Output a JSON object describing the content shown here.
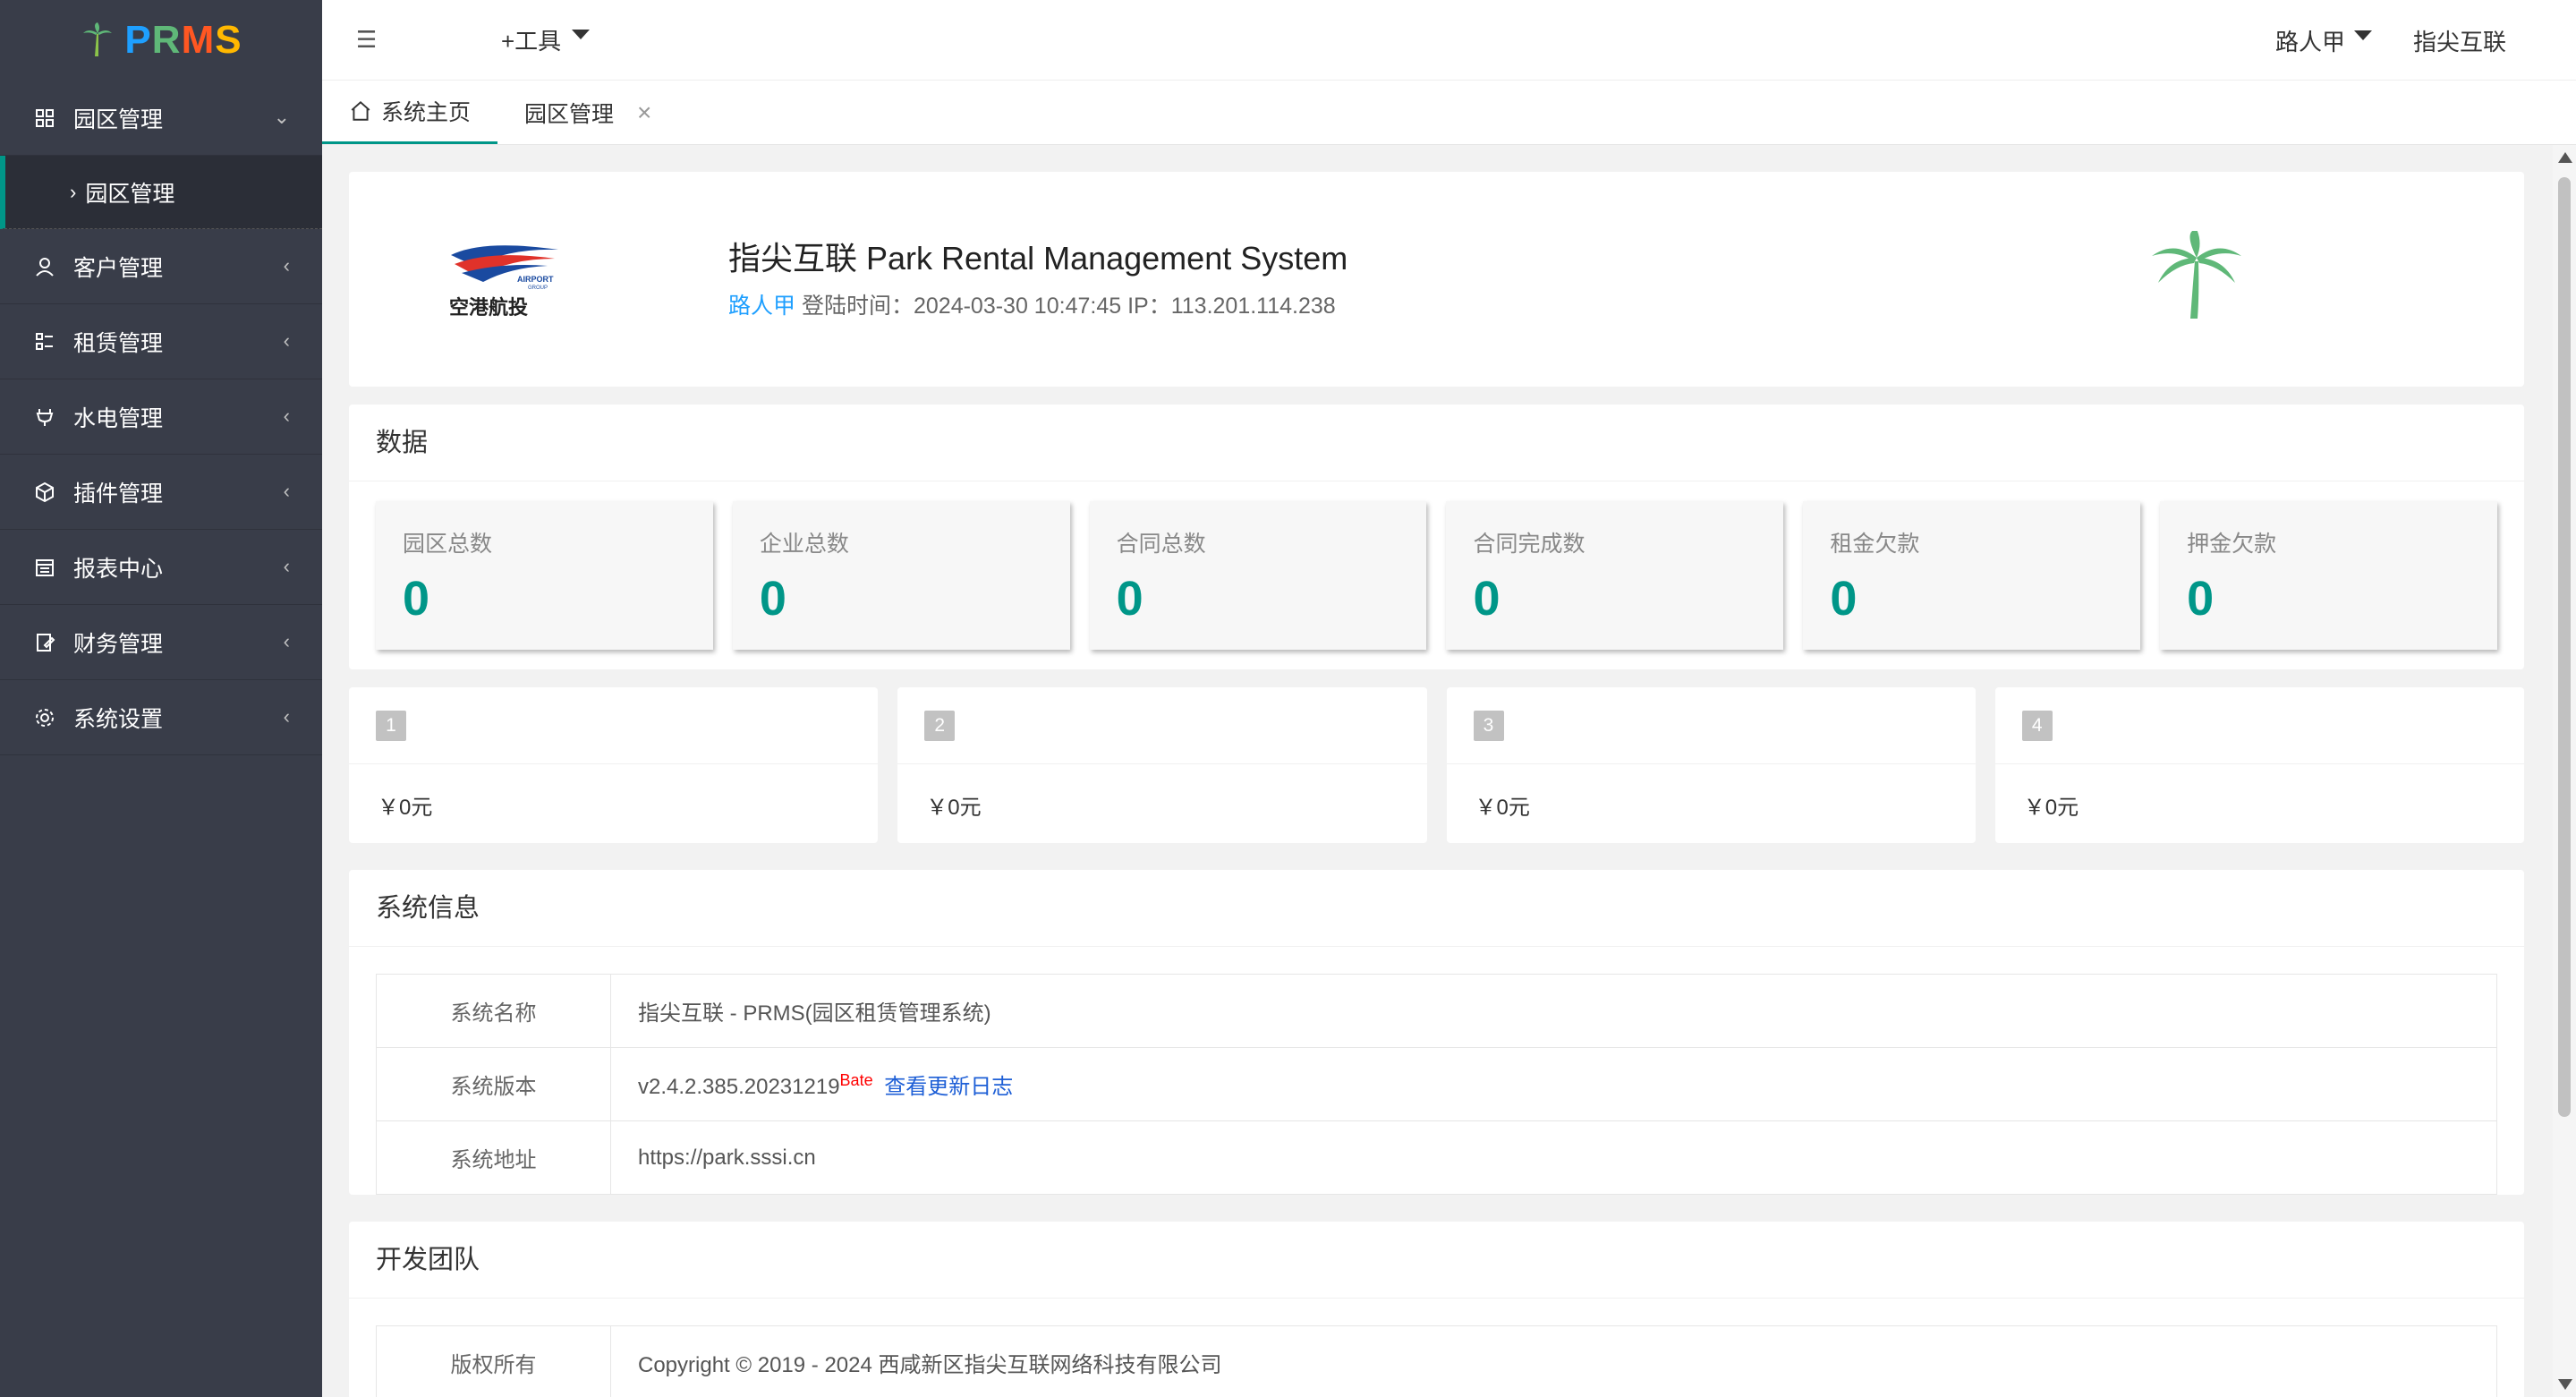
{
  "app": {
    "logo_letters": [
      "P",
      "R",
      "M",
      "S"
    ]
  },
  "colors": {
    "sidebar_bg": "#393d49",
    "accent": "#009688",
    "link_blue": "#1e9fff"
  },
  "sidebar": {
    "items": [
      {
        "label": "园区管理",
        "icon": "grid-icon",
        "expanded": true
      },
      {
        "label": "客户管理",
        "icon": "user-icon"
      },
      {
        "label": "租赁管理",
        "icon": "list-icon"
      },
      {
        "label": "水电管理",
        "icon": "plug-icon"
      },
      {
        "label": "插件管理",
        "icon": "cube-icon"
      },
      {
        "label": "报表中心",
        "icon": "report-icon"
      },
      {
        "label": "财务管理",
        "icon": "finance-icon"
      },
      {
        "label": "系统设置",
        "icon": "gear-icon"
      }
    ],
    "subitem": {
      "label": "园区管理"
    }
  },
  "header": {
    "tools_label": "+工具",
    "user_name": "路人甲",
    "company": "指尖互联"
  },
  "tabs": [
    {
      "label": "系统主页",
      "active": true
    },
    {
      "label": "园区管理",
      "active": false
    }
  ],
  "welcome": {
    "logo_cn": "空港航投",
    "logo_en_1": "AIRPORT",
    "logo_en_2": "GROUP",
    "title": "指尖互联 Park Rental Management System",
    "user": "路人甲",
    "login_label": "登陆时间：",
    "login_time": "2024-03-30 10:47:45",
    "ip_label": "IP：",
    "ip": "113.201.114.238"
  },
  "data_section": {
    "title": "数据",
    "stats": [
      {
        "label": "园区总数",
        "value": "0"
      },
      {
        "label": "企业总数",
        "value": "0"
      },
      {
        "label": "合同总数",
        "value": "0"
      },
      {
        "label": "合同完成数",
        "value": "0"
      },
      {
        "label": "租金欠款",
        "value": "0"
      },
      {
        "label": "押金欠款",
        "value": "0"
      }
    ]
  },
  "money_cards": [
    {
      "badge": "1",
      "value": "￥0元"
    },
    {
      "badge": "2",
      "value": "￥0元"
    },
    {
      "badge": "3",
      "value": "￥0元"
    },
    {
      "badge": "4",
      "value": "￥0元"
    }
  ],
  "system_info": {
    "title": "系统信息",
    "rows": [
      {
        "key": "系统名称",
        "value": "指尖互联 - PRMS(园区租赁管理系统)"
      },
      {
        "key": "系统版本",
        "value": "v2.4.2.385.20231219",
        "sup": "Bate",
        "link": "查看更新日志"
      },
      {
        "key": "系统地址",
        "value": "https://park.sssi.cn"
      }
    ]
  },
  "dev_team": {
    "title": "开发团队",
    "rows": [
      {
        "key": "版权所有",
        "value": "Copyright © 2019 - 2024 西咸新区指尖互联网络科技有限公司"
      }
    ]
  }
}
